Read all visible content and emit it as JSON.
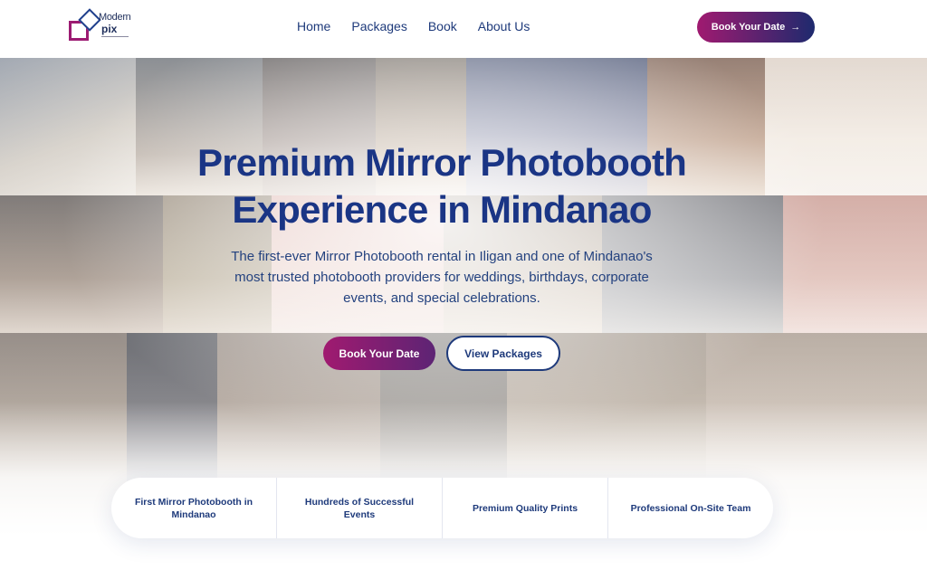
{
  "brand": {
    "line1": "Modern",
    "line2": "pix"
  },
  "nav": {
    "items": [
      "Home",
      "Packages",
      "Book",
      "About Us"
    ]
  },
  "header_cta": {
    "label": "Book Your Date",
    "arrow": "→"
  },
  "hero": {
    "title_line1": "Premium Mirror Photobooth",
    "title_line2": "Experience in Mindanao",
    "subtitle": "The first-ever Mirror Photobooth rental in Iligan and one of Mindanao's most trusted photobooth providers for weddings, birthdays, corporate events, and special celebrations.",
    "primary_button": "Book Your Date",
    "secondary_button": "View Packages"
  },
  "features": [
    "First Mirror Photobooth in Mindanao",
    "Hundreds of Successful Events",
    "Premium Quality Prints",
    "Professional On-Site Team"
  ],
  "colors": {
    "primary_navy": "#1e3a7b",
    "accent_magenta": "#a01a70"
  }
}
